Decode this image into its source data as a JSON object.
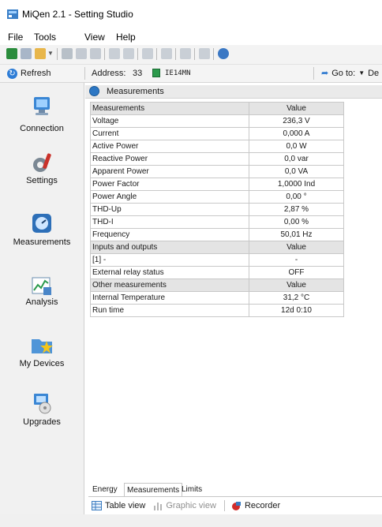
{
  "window": {
    "title": "MiQen 2.1 - Setting Studio"
  },
  "menu": {
    "items": [
      "File",
      "Tools",
      "View",
      "Help"
    ]
  },
  "addressbar": {
    "refresh_label": "Refresh",
    "address_label": "Address:",
    "address_value": "33",
    "device_name": "IE14MN",
    "goto_label": "Go to:",
    "goto_value": "De"
  },
  "sidebar": {
    "items": [
      {
        "label": "Connection",
        "icon": "computer-icon"
      },
      {
        "label": "Settings",
        "icon": "tools-icon"
      },
      {
        "label": "Measurements",
        "icon": "gauge-icon"
      },
      {
        "label": "Analysis",
        "icon": "chart-icon"
      },
      {
        "label": "My Devices",
        "icon": "folder-star-icon"
      },
      {
        "label": "Upgrades",
        "icon": "upgrade-icon"
      }
    ]
  },
  "content": {
    "title": "Measurements",
    "table": {
      "sections": [
        {
          "header": [
            "Measurements",
            "Value"
          ],
          "rows": [
            [
              "Voltage",
              "236,3  V"
            ],
            [
              "Current",
              "0,000  A"
            ],
            [
              "Active Power",
              "0,0  W"
            ],
            [
              "Reactive Power",
              "0,0  var"
            ],
            [
              "Apparent Power",
              "0,0  VA"
            ],
            [
              "Power Factor",
              "1,0000 Ind"
            ],
            [
              "Power Angle",
              "0,00 °"
            ],
            [
              "THD-Up",
              "2,87 %"
            ],
            [
              "THD-I",
              "0,00 %"
            ],
            [
              "Frequency",
              "50,01  Hz"
            ]
          ]
        },
        {
          "header": [
            "Inputs and outputs",
            "Value"
          ],
          "rows": [
            [
              "[1] -",
              "-"
            ],
            [
              "External relay status",
              "OFF"
            ]
          ]
        },
        {
          "header": [
            "Other measurements",
            "Value"
          ],
          "rows": [
            [
              "Internal Temperature",
              "31,2 °C"
            ],
            [
              "Run time",
              "12d 0:10"
            ]
          ]
        }
      ]
    }
  },
  "tabs": {
    "items": [
      "Energy",
      "Measurements",
      "Limits"
    ],
    "active": "Measurements"
  },
  "viewbar": {
    "table_view": "Table view",
    "graphic_view": "Graphic view",
    "recorder": "Recorder"
  },
  "colors": {
    "accent": "#2d77c4",
    "sidebar_bg": "#f1f1f1",
    "table_header_bg": "#e4e4e4"
  }
}
